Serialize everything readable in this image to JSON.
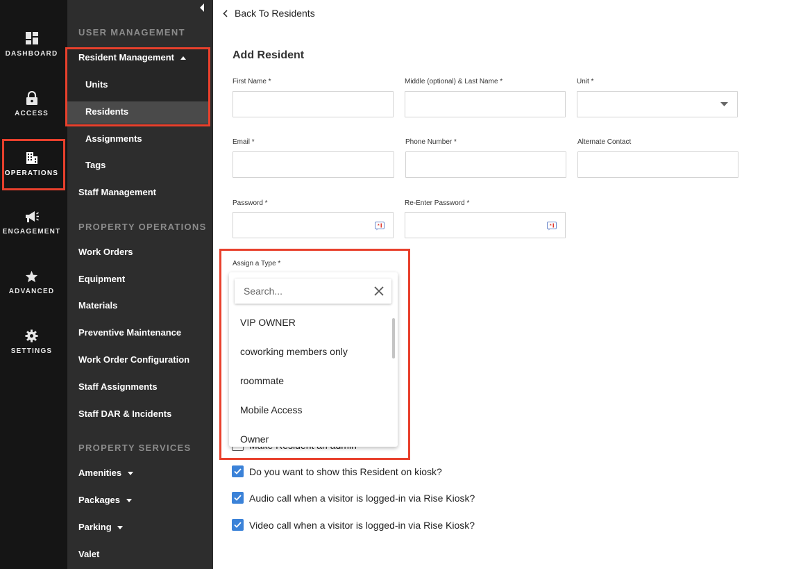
{
  "rail": {
    "dashboard": "DASHBOARD",
    "access": "ACCESS",
    "operations": "OPERATIONS",
    "engagement": "ENGAGEMENT",
    "advanced": "ADVANCED",
    "settings": "SETTINGS"
  },
  "nav": {
    "user_management": "USER MANAGEMENT",
    "resident_management": "Resident Management",
    "units": "Units",
    "residents": "Residents",
    "assignments": "Assignments",
    "tags": "Tags",
    "staff_management": "Staff Management",
    "property_operations": "PROPERTY OPERATIONS",
    "work_orders": "Work Orders",
    "equipment": "Equipment",
    "materials": "Materials",
    "preventive_maintenance": "Preventive Maintenance",
    "work_order_configuration": "Work Order Configuration",
    "staff_assignments": "Staff Assignments",
    "staff_dar": "Staff DAR & Incidents",
    "property_services": "PROPERTY SERVICES",
    "amenities": "Amenities",
    "packages": "Packages",
    "parking": "Parking",
    "valet": "Valet"
  },
  "main": {
    "back_label": "Back To Residents",
    "title": "Add Resident",
    "fields": {
      "first_name": "First Name *",
      "middle_last_name": "Middle (optional) & Last Name *",
      "unit": "Unit *",
      "email": "Email *",
      "phone": "Phone Number *",
      "alternate_contact": "Alternate Contact",
      "password": "Password *",
      "reenter_password": "Re-Enter Password *",
      "assign_type": "Assign a Type *"
    },
    "type_dropdown": {
      "search_placeholder": "Search...",
      "options": [
        "VIP OWNER",
        "coworking members only",
        "roommate",
        "Mobile Access",
        "Owner"
      ]
    },
    "checkboxes": {
      "partial_hidden": "Make Resident an admin",
      "show_on_kiosk": "Do you want to show this Resident on kiosk?",
      "audio_call": "Audio call when a visitor is logged-in via Rise Kiosk?",
      "video_call": "Video call when a visitor is logged-in via Rise Kiosk?"
    }
  },
  "colors": {
    "highlight_red": "#e8402c",
    "checkbox_blue": "#3b82d8",
    "rail_bg": "#151515",
    "nav_bg": "#2d2d2d"
  }
}
